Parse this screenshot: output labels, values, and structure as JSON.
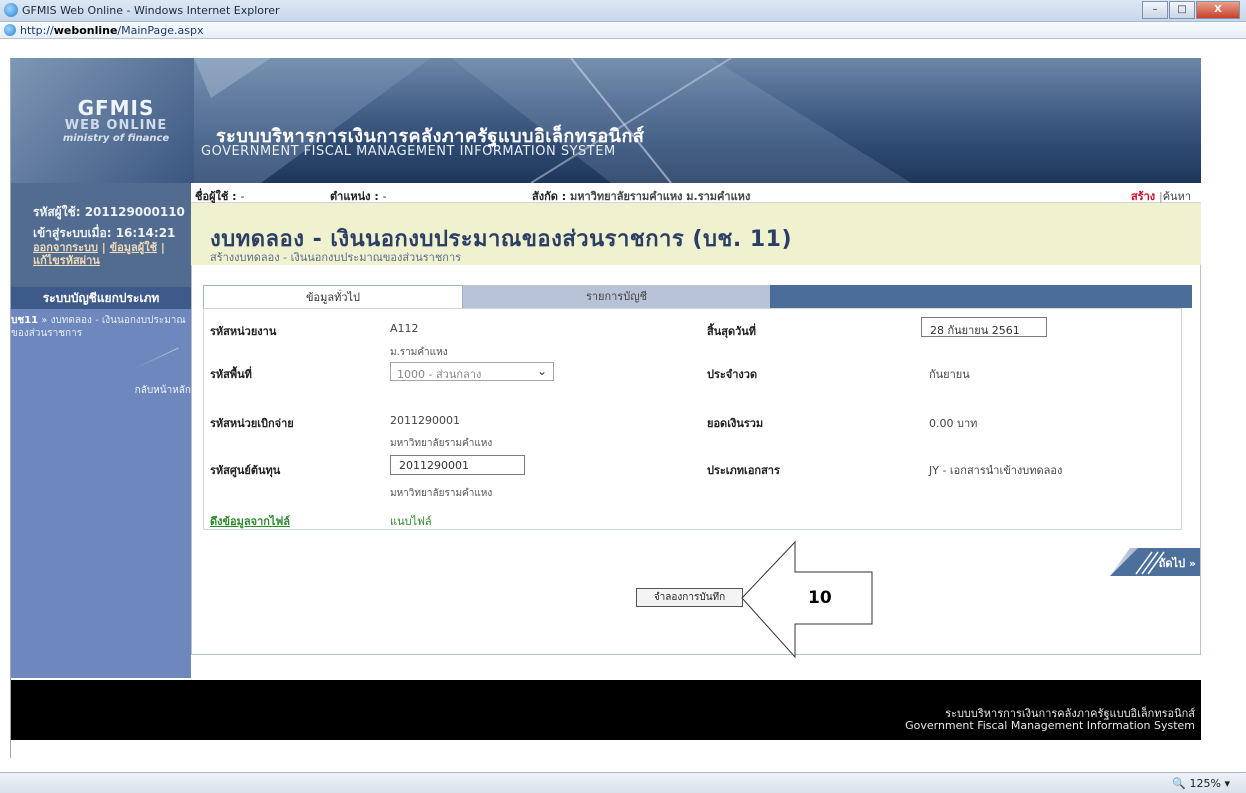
{
  "browser": {
    "window_title": "GFMIS Web Online - Windows Internet Explorer",
    "url_prefix": "http://",
    "url_host": "webonline",
    "url_path": "/MainPage.aspx",
    "zoom": "125%",
    "min_label": "–",
    "max_label": "□",
    "close_label": "X"
  },
  "banner": {
    "logo_line1": "GFMIS",
    "logo_line2": "WEB ONLINE",
    "logo_line3": "ministry of finance",
    "system_name_th": "ระบบบริหารการเงินการคลังภาครัฐแบบอิเล็กทรอนิกส์",
    "system_name_en": "GOVERNMENT FISCAL MANAGEMENT INFORMATION SYSTEM"
  },
  "user": {
    "id_label": "รหัสผู้ใช้:",
    "id_value": "201129000110",
    "login_label": "เข้าสู่ระบบเมื่อ:",
    "login_time": "16:14:21",
    "logout_link": "ออกจากระบบ",
    "profile_link": "ข้อมูลผู้ใช้",
    "password_link": "แก้ไขรหัสผ่าน",
    "sep": "|"
  },
  "nav": {
    "menu_title": "ระบบบัญชีแยกประเภท",
    "item_code": "บช11",
    "item_arrow": "»",
    "item_label": "งบทดลอง - เงินนอกงบประมาณของส่วนราชการ",
    "back_home": "กลับหน้าหลัก"
  },
  "info": {
    "user_label": "ชื่อผู้ใช้ :",
    "user_value": "-",
    "position_label": "ตำแหน่ง :",
    "position_value": "-",
    "affiliation_label": "สังกัด :",
    "affiliation_value": "มหาวิทยาลัยรามคำแหง ม.รามคำแหง",
    "create": "สร้าง",
    "sep": "|",
    "search": "ค้นหา"
  },
  "header": {
    "title": "งบทดลอง - เงินนอกงบประมาณของส่วนราชการ (บช. 11)",
    "subtitle": "สร้างงบทดลอง - เงินนอกงบประมาณของส่วนราชการ"
  },
  "tabs": [
    {
      "label": "ข้อมูลทั่วไป"
    },
    {
      "label": "รายการบัญชี"
    }
  ],
  "form": {
    "agency_code_label": "รหัสหน่วยงาน",
    "agency_code_value": "A112",
    "agency_name": "ม.รามคำแหง",
    "area_code_label": "รหัสพื้นที่",
    "area_code_value": "1000 - ส่วนกลาง",
    "disburse_unit_label": "รหัสหน่วยเบิกจ่าย",
    "disburse_unit_value": "2011290001",
    "disburse_unit_name": "มหาวิทยาลัยรามคำแหง",
    "cost_center_label": "รหัสศูนย์ต้นทุน",
    "cost_center_value": "2011290001",
    "cost_center_name": "มหาวิทยาลัยรามคำแหง",
    "end_date_label": "สิ้นสุดวันที่",
    "end_date_value": "28 กันยายน 2561",
    "period_label": "ประจำงวด",
    "period_value": "กันยายน",
    "total_label": "ยอดเงินรวม",
    "total_value": "0.00 บาท",
    "doc_type_label": "ประเภทเอกสาร",
    "doc_type_value": "JY - เอกสารนำเข้างบทดลอง",
    "import_link": "ดึงข้อมูลจากไฟล์",
    "attach_link": "แนบไฟล์"
  },
  "actions": {
    "next_label": "ถัดไป »",
    "simulate_label": "จำลองการบันทึก",
    "callout_number": "10"
  },
  "footer": {
    "line_th": "ระบบบริหารการเงินการคลังภาครัฐแบบอิเล็กทรอนิกส์",
    "line_en": "Government Fiscal Management Information System"
  },
  "colors": {
    "nav_bg": "#6e88bd",
    "title_bg": "#eff1cf",
    "tab_bar": "#4b6e98",
    "create_red": "#c8102e",
    "link_green": "#2f8a2f"
  }
}
